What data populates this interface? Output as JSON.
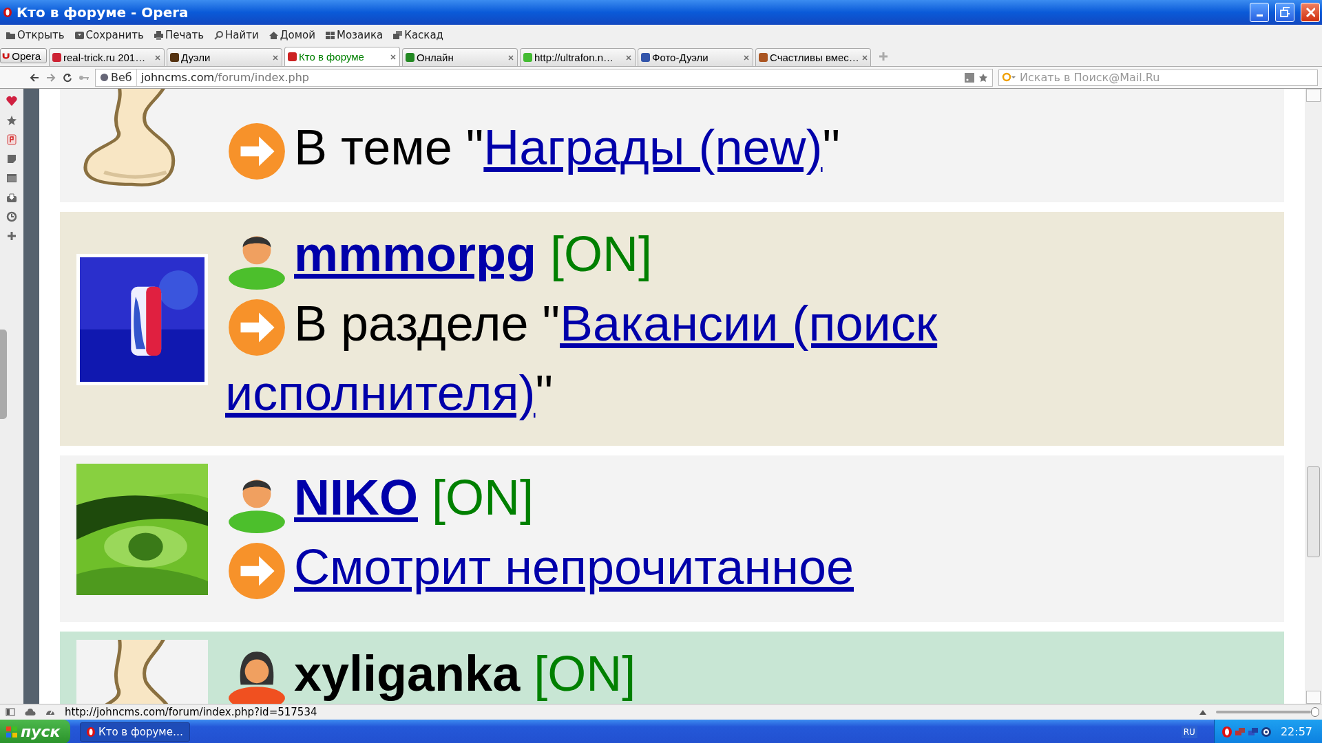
{
  "window": {
    "title": "Кто в форуме - Opera"
  },
  "toolbar": [
    {
      "label": "Открыть",
      "kind": "folder"
    },
    {
      "label": "Сохранить",
      "kind": "save"
    },
    {
      "label": "Печать",
      "kind": "print"
    },
    {
      "label": "Найти",
      "kind": "search"
    },
    {
      "label": "Домой",
      "kind": "home"
    },
    {
      "label": "Мозаика",
      "kind": "tile"
    },
    {
      "label": "Каскад",
      "kind": "cascade"
    }
  ],
  "opera_button": "Opera",
  "tabs": [
    {
      "label": "real-trick.ru 201…",
      "selected": false,
      "color": "#cc2233"
    },
    {
      "label": "Дуэли",
      "selected": false,
      "color": "#553311"
    },
    {
      "label": "Кто в форуме",
      "selected": true,
      "color": "#cc2222"
    },
    {
      "label": "Онлайн",
      "selected": false,
      "color": "#228822"
    },
    {
      "label": "http://ultrafon.n…",
      "selected": false,
      "color": "#44bb33"
    },
    {
      "label": "Фото-Дуэли",
      "selected": false,
      "color": "#3355aa"
    },
    {
      "label": "Счастливы вмес…",
      "selected": false,
      "color": "#aa5522"
    }
  ],
  "address": {
    "scope": "Веб",
    "url_host": "johncms.com",
    "url_path": "/forum/index.php"
  },
  "search": {
    "placeholder": "Искать в Поиск@Mail.Ru"
  },
  "users": [
    {
      "color": "#f3f3f3",
      "status_prefix": "В теме \"",
      "status_link_lines": [
        "Награды (new)"
      ],
      "status_suffix": "\""
    },
    {
      "color": "#ede9d9",
      "name": "mmmorpg",
      "name_is_link": true,
      "kind": "male",
      "online": "[ON]",
      "status_prefix": "В разделе \"",
      "status_link_lines": [
        "Вакансии (поиск",
        "исполнителя)"
      ],
      "status_suffix": "\""
    },
    {
      "color": "#f3f3f3",
      "name": "NIKO",
      "name_is_link": true,
      "kind": "male",
      "online": "[ON]",
      "status_link_lines": [
        "Смотрит непрочитанное"
      ]
    },
    {
      "color": "#c8e6d4",
      "name": "xyliganka",
      "name_is_link": false,
      "kind": "female",
      "online": "[ON]"
    }
  ],
  "status_bar": {
    "url": "http://johncms.com/forum/index.php?id=517534",
    "zoom": {
      "level": 1
    }
  },
  "taskbar": {
    "start": "пуск",
    "tasks": [
      {
        "label": "Кто в форуме…",
        "selected": true
      }
    ],
    "language": "RU",
    "clock": "22:57"
  }
}
